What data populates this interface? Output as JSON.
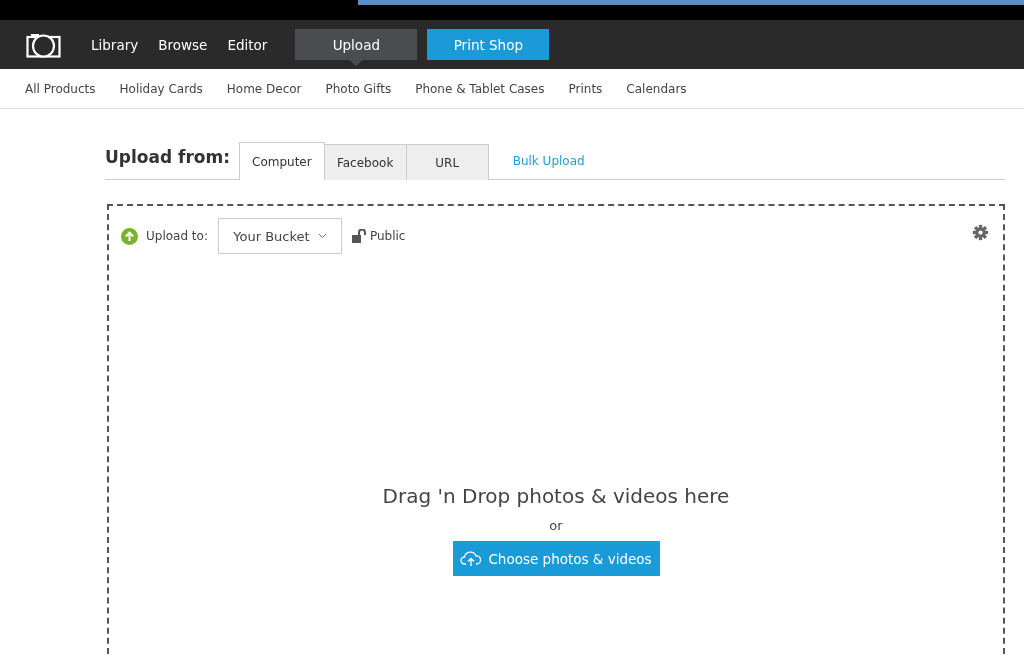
{
  "nav": {
    "items": [
      {
        "label": "Library",
        "kind": "link",
        "selected": false
      },
      {
        "label": "Browse",
        "kind": "link",
        "selected": false
      },
      {
        "label": "Editor",
        "kind": "link",
        "selected": false
      },
      {
        "label": "Upload",
        "kind": "tab",
        "selected": true
      },
      {
        "label": "Print Shop",
        "kind": "primary",
        "selected": false
      }
    ]
  },
  "categories": [
    "All Products",
    "Holiday Cards",
    "Home Decor",
    "Photo Gifts",
    "Phone & Tablet Cases",
    "Prints",
    "Calendars"
  ],
  "upload_from": {
    "title": "Upload from:",
    "tabs": [
      {
        "label": "Computer",
        "selected": true
      },
      {
        "label": "Facebook",
        "selected": false
      },
      {
        "label": "URL",
        "selected": false
      }
    ],
    "link": "Bulk Upload"
  },
  "dropzone": {
    "upload_to_label": "Upload to:",
    "album": "Your Bucket",
    "privacy": "Public",
    "heading": "Drag 'n Drop photos & videos here",
    "or": "or",
    "button": "Choose photos & videos"
  }
}
